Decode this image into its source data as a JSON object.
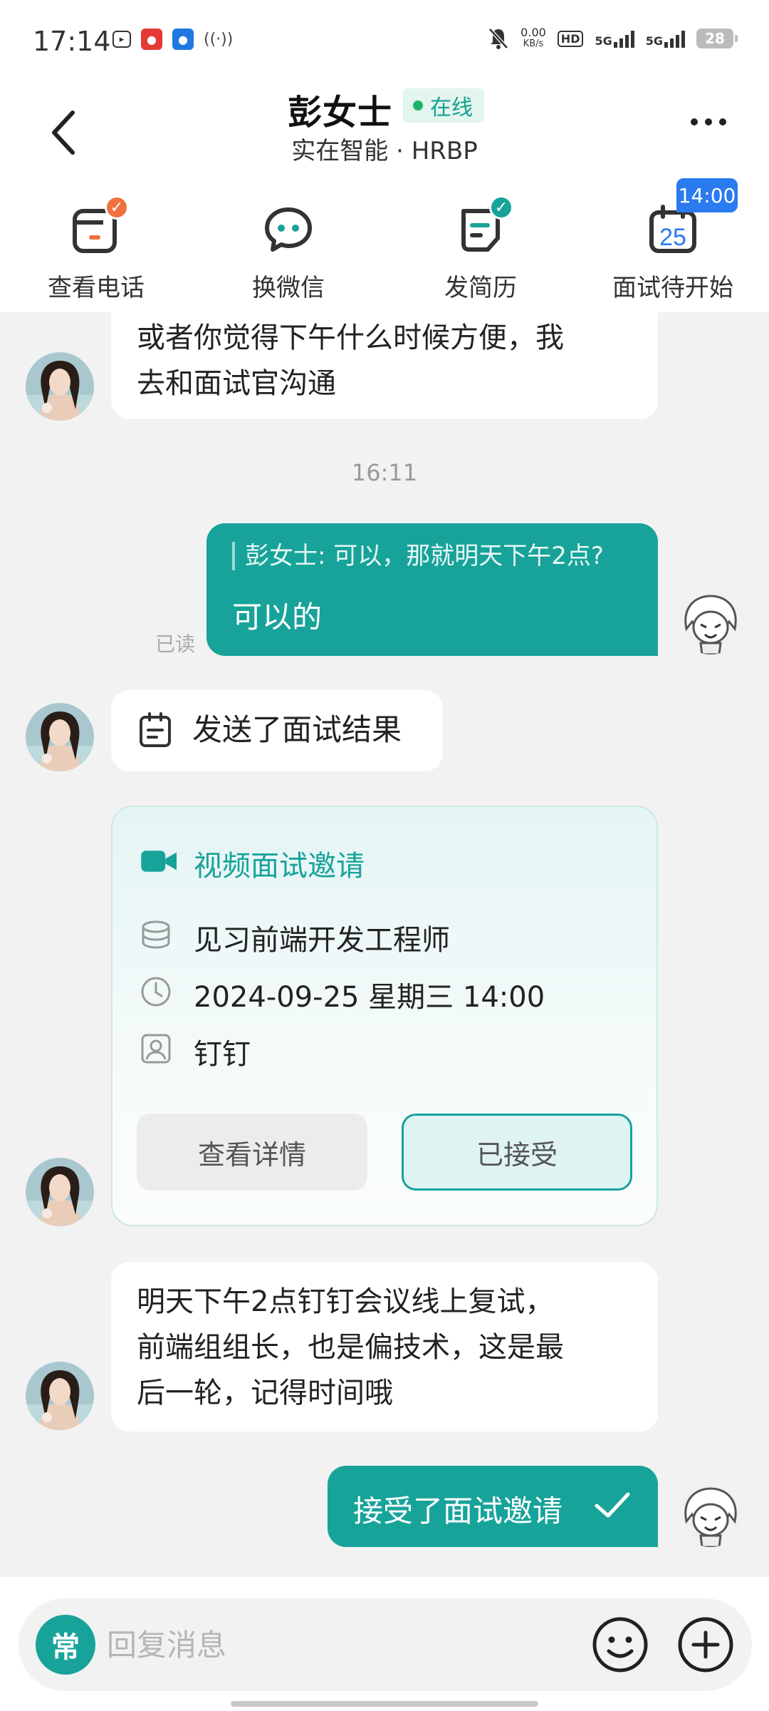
{
  "status_bar": {
    "time": "17:14",
    "net_speed_value": "0.00",
    "net_speed_unit": "KB/s",
    "hd_label": "HD",
    "signal1_label": "5G",
    "signal2_label": "5G",
    "battery": "28"
  },
  "header": {
    "name": "彭女士",
    "status": "在线",
    "subtitle": "实在智能 · HRBP",
    "actions": [
      {
        "label": "查看电话",
        "icon": "phone-card-icon"
      },
      {
        "label": "换微信",
        "icon": "wechat-icon"
      },
      {
        "label": "发简历",
        "icon": "resume-icon"
      },
      {
        "label": "面试待开始",
        "icon": "calendar-icon",
        "day": "25",
        "badge": "14:00"
      }
    ]
  },
  "messages": {
    "m1": {
      "lines": [
        "或者你觉得下午什么时候方便，我",
        "去和面试官沟通"
      ]
    },
    "timestamp": "16:11",
    "m2": {
      "quote": "彭女士: 可以，那就明天下午2点?",
      "text": "可以的",
      "read": "已读"
    },
    "m3": {
      "text": "发送了面试结果"
    },
    "invite": {
      "title": "视频面试邀请",
      "position": "见习前端开发工程师",
      "datetime": "2024-09-25 星期三 14:00",
      "platform": "钉钉",
      "details_button": "查看详情",
      "accepted_button": "已接受"
    },
    "m5": {
      "lines": [
        "明天下午2点钉钉会议线上复试，",
        "前端组组长，也是偏技术，这是最",
        "后一轮，记得时间哦"
      ]
    },
    "m6": {
      "text": "接受了面试邀请"
    }
  },
  "input": {
    "common_phrases": "常",
    "placeholder": "回复消息"
  },
  "colors": {
    "accent": "#17a39a",
    "online": "#1bb56a",
    "badge_blue": "#2a7af0",
    "check_orange": "#f0713f"
  }
}
